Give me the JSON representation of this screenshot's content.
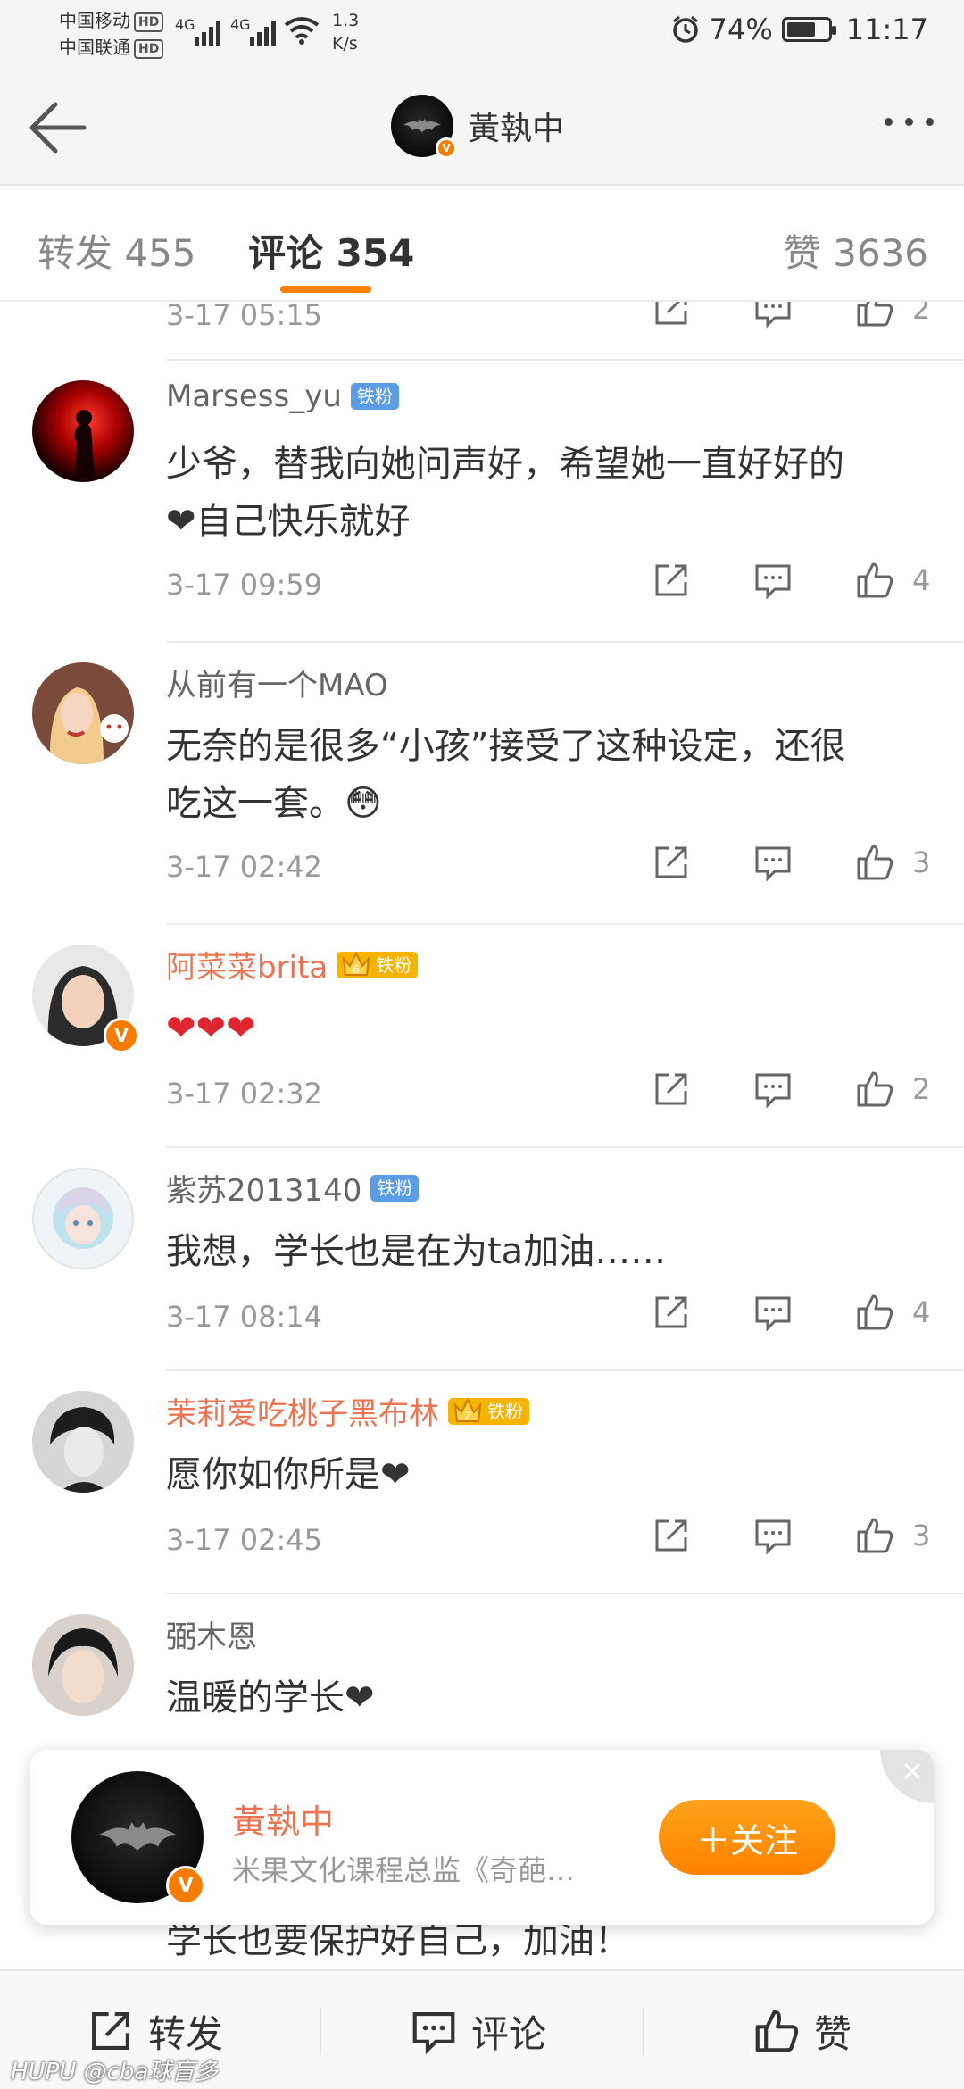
{
  "status_bar": {
    "carrier_1": "中国移动",
    "carrier_2": "中国联通",
    "hd_badge": "HD",
    "net_1": "4G",
    "net_2": "4G",
    "speed_value": "1.3",
    "speed_unit": "K/s",
    "battery": "74%",
    "battery_level": 0.74,
    "time": "11:17",
    "alarm_icon": "alarm-icon",
    "wifi_icon": "wifi-icon"
  },
  "header": {
    "title": "黃執中",
    "back_icon": "back-arrow-icon",
    "more_icon": "more-dots-icon"
  },
  "tabs": [
    {
      "label": "转发 455",
      "active": false
    },
    {
      "label": "评论 354",
      "active": true
    },
    {
      "label": "赞 3636",
      "active": false
    }
  ],
  "partial_comment": {
    "time": "3-17 05:15",
    "likes": "2"
  },
  "comments": [
    {
      "name": "Marsess_yu",
      "badge": "铁粉",
      "badge_style": "blue",
      "text_1": "少爷，替我向她问声好，希望她一直好好的",
      "text_2": "❤自己快乐就好",
      "time": "3-17 09:59",
      "likes": "4"
    },
    {
      "name": "从前有一个MAO",
      "badge": "",
      "badge_style": "",
      "text_1": "无奈的是很多“小孩”接受了这种设定，还很",
      "text_2": "吃这一套。😳",
      "time": "3-17 02:42",
      "likes": "3"
    },
    {
      "name": "阿菜菜brita",
      "badge": "铁粉",
      "badge_style": "gold",
      "crown_level": "6",
      "text_1": "❤❤❤",
      "text_2": "",
      "time": "3-17 02:32",
      "likes": "2"
    },
    {
      "name": "紫苏2013140",
      "badge": "铁粉",
      "badge_style": "blue",
      "text_1": "我想，学长也是在为ta加油……",
      "text_2": "",
      "time": "3-17 08:14",
      "likes": "4"
    },
    {
      "name": "茉莉爱吃桃子黑布林",
      "badge": "铁粉",
      "badge_style": "gold",
      "crown_level": "2",
      "text_1": "愿你如你所是❤",
      "text_2": "",
      "time": "3-17 02:45",
      "likes": "3"
    },
    {
      "name": "弼木恩",
      "badge": "",
      "badge_style": "",
      "text_1": "温暖的学长❤",
      "text_2": "",
      "time": "",
      "likes": ""
    }
  ],
  "hidden_comment": {
    "text": "学长也要保护好自己，加油！"
  },
  "follow_card": {
    "name": "黃執中",
    "desc": "米果文化课程总监《奇葩…",
    "button": "＋关注",
    "close_icon": "close-icon"
  },
  "bottom_bar": {
    "repost": "转发",
    "comment": "评论",
    "like": "赞",
    "repost_icon": "share-icon",
    "comment_icon": "comment-icon",
    "like_icon": "thumb-up-icon"
  },
  "watermark": {
    "brand": "HUPU",
    "handle": "@cba球盲多"
  },
  "colors": {
    "accent": "#ff8200",
    "vip_name": "#eb7350",
    "badge_blue": "#5b9ce6",
    "badge_gold": "#f5b400"
  }
}
